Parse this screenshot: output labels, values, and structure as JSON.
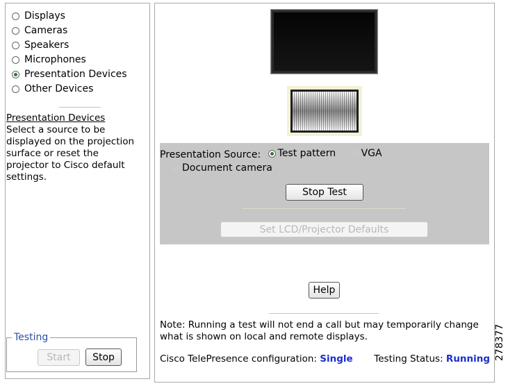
{
  "devices": [
    {
      "label": "Displays",
      "selected": false
    },
    {
      "label": "Cameras",
      "selected": false
    },
    {
      "label": "Speakers",
      "selected": false
    },
    {
      "label": "Microphones",
      "selected": false
    },
    {
      "label": "Presentation Devices",
      "selected": true
    },
    {
      "label": "Other Devices",
      "selected": false
    }
  ],
  "help": {
    "title": "Presentation Devices",
    "text": "Select a source to be displayed on the projection surface or reset the projector to Cisco default settings."
  },
  "testing": {
    "legend": "Testing",
    "start_label": "Start",
    "stop_label": "Stop"
  },
  "presentation": {
    "source_label": "Presentation Source:",
    "options": [
      {
        "label": "Test pattern",
        "selected": true,
        "enabled": true
      },
      {
        "label": "VGA",
        "selected": false,
        "enabled": false
      },
      {
        "label": "Document camera",
        "selected": false,
        "enabled": false
      }
    ],
    "stop_test_label": "Stop Test",
    "defaults_label": "Set LCD/Projector Defaults"
  },
  "help_button_label": "Help",
  "note": "Note: Running a test will not end a call but may temporarily change what is shown on local and remote displays.",
  "status": {
    "config_label": "Cisco TelePresence configuration:",
    "config_value": "Single",
    "testing_label": "Testing Status:",
    "testing_value": "Running"
  },
  "figure_id": "278377",
  "colors": {
    "selected_radio": "#2a7a2a",
    "status_value": "#1a2fd0",
    "legend": "#2a4fa8",
    "source_box_bg": "#c6c6c6"
  }
}
